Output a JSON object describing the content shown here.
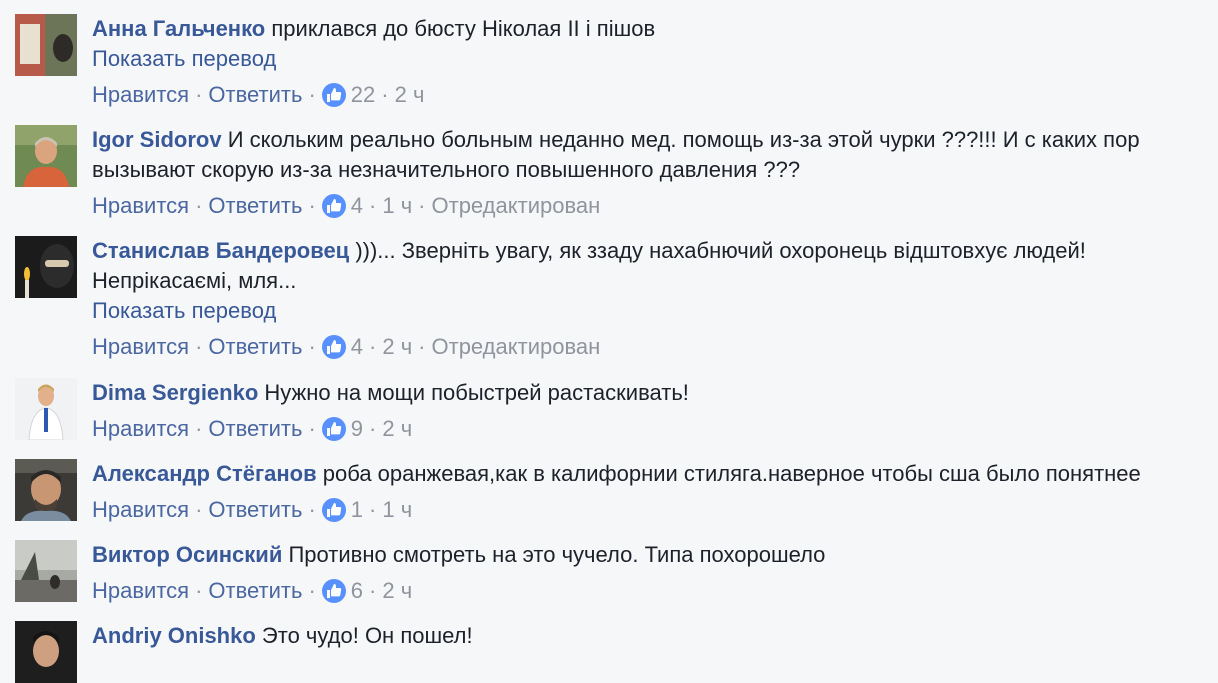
{
  "comments": [
    {
      "author": "Анна Гальченко",
      "text": "приклався до бюсту Ніколая II і пішов",
      "translate": "Показать перевод",
      "like": "Нравится",
      "reply": "Ответить",
      "likes": "22",
      "time": "2 ч",
      "edited": "",
      "avatar_icon": "user-photo-icon"
    },
    {
      "author": "Igor Sidorov",
      "text": "И скольким реально больным неданно мед. помощь из-за этой чурки ???!!! И с каких пор вызывают скорую из-за незначительного повышенного давления ???",
      "translate": "",
      "like": "Нравится",
      "reply": "Ответить",
      "likes": "4",
      "time": "1 ч",
      "edited": "Отредактирован",
      "avatar_icon": "user-photo-icon"
    },
    {
      "author": "Станислав Бандеровец",
      "text": ")))... Зверніть увагу, як ззаду нахабнючий охоронець відштовхує людей! Непрікасаємі, мля...",
      "translate": "Показать перевод",
      "like": "Нравится",
      "reply": "Ответить",
      "likes": "4",
      "time": "2 ч",
      "edited": "Отредактирован",
      "avatar_icon": "user-photo-icon"
    },
    {
      "author": "Dima Sergienko",
      "text": "Нужно на мощи побыстрей растаскивать!",
      "translate": "",
      "like": "Нравится",
      "reply": "Ответить",
      "likes": "9",
      "time": "2 ч",
      "edited": "",
      "avatar_icon": "user-photo-icon"
    },
    {
      "author": "Александр Стёганов",
      "text": "роба оранжевая,как в калифорнии стиляга.наверное чтобы сша было понятнее",
      "translate": "",
      "like": "Нравится",
      "reply": "Ответить",
      "likes": "1",
      "time": "1 ч",
      "edited": "",
      "avatar_icon": "user-photo-icon"
    },
    {
      "author": "Виктор Осинский",
      "text": "Противно смотреть на это чучело. Типа похорошело",
      "translate": "",
      "like": "Нравится",
      "reply": "Ответить",
      "likes": "6",
      "time": "2 ч",
      "edited": "",
      "avatar_icon": "user-photo-icon"
    },
    {
      "author": "Andriy Onishko",
      "text": "Это чудо! Он пошел!",
      "translate": "",
      "like": "",
      "reply": "",
      "likes": "",
      "time": "",
      "edited": "",
      "avatar_icon": "user-photo-icon"
    }
  ],
  "colors": {
    "background": "#f6f7f9",
    "author_link": "#385898",
    "action_link": "#4b67a1",
    "meta_gray": "#90949c",
    "like_badge": "#5890ff"
  }
}
